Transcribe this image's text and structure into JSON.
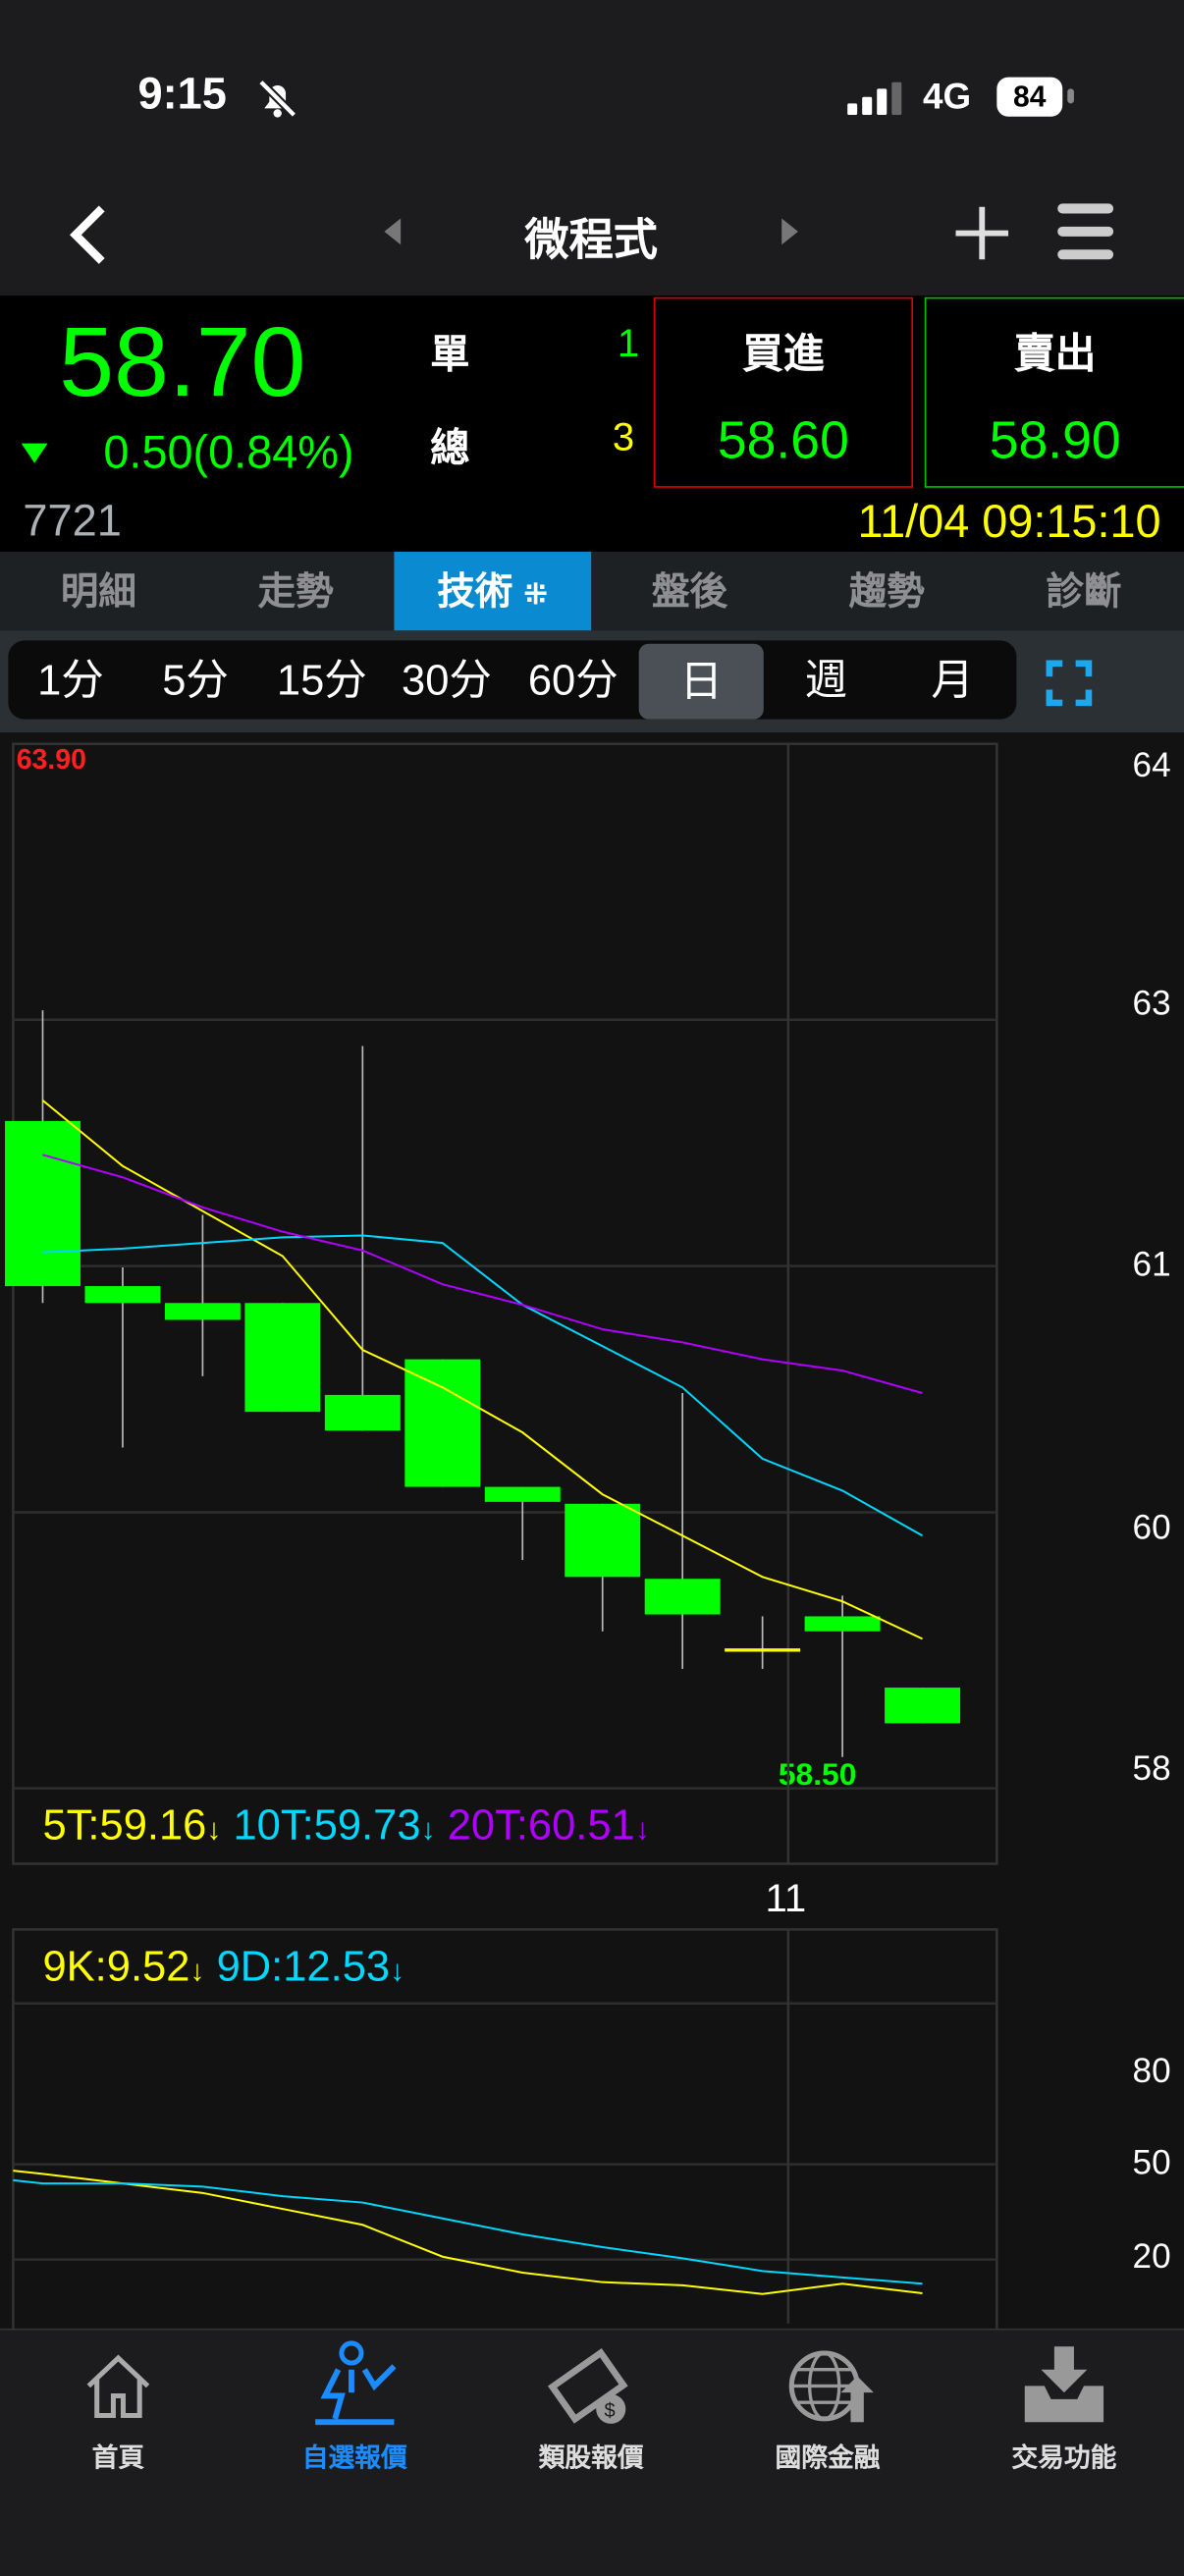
{
  "status_bar": {
    "time": "9:15",
    "network": "4G",
    "battery": "84"
  },
  "nav": {
    "title": "微程式"
  },
  "quote": {
    "price": "58.70",
    "change": "0.50(0.84%)",
    "unit_label": "單",
    "unit_value": "1",
    "total_label": "總",
    "total_value": "3",
    "bid_label": "買進",
    "bid_price": "58.60",
    "ask_label": "賣出",
    "ask_price": "58.90",
    "code": "7721",
    "datetime": "11/04 09:15:10"
  },
  "tabs": [
    {
      "label": "明細"
    },
    {
      "label": "走勢"
    },
    {
      "label": "技術"
    },
    {
      "label": "盤後"
    },
    {
      "label": "趨勢"
    },
    {
      "label": "診斷"
    }
  ],
  "periods": [
    {
      "label": "1分"
    },
    {
      "label": "5分"
    },
    {
      "label": "15分"
    },
    {
      "label": "30分"
    },
    {
      "label": "60分"
    },
    {
      "label": "日"
    },
    {
      "label": "週"
    },
    {
      "label": "月"
    }
  ],
  "colors": {
    "up": "#ff0000",
    "down": "#00ff00",
    "ma5": "#ffff00",
    "ma10": "#00d8ff",
    "ma20": "#b000ff",
    "accent": "#0a8bd1"
  },
  "chart_data": [
    {
      "type": "candlestick",
      "title": "日K",
      "high_label": "63.90",
      "low_label": "58.50",
      "y_tick_labels": [
        "64",
        "63",
        "61",
        "60",
        "58"
      ],
      "x_tick_labels": [
        "11"
      ],
      "ylim": [
        58.5,
        63.9
      ],
      "candles": [
        {
          "o": 61.89,
          "h": 62.48,
          "l": 60.92,
          "c": 61.01
        },
        {
          "o": 61.01,
          "h": 61.11,
          "l": 60.15,
          "c": 60.92
        },
        {
          "o": 60.92,
          "h": 61.39,
          "l": 60.53,
          "c": 60.83
        },
        {
          "o": 60.92,
          "h": 60.92,
          "l": 60.34,
          "c": 60.34
        },
        {
          "o": 60.43,
          "h": 62.29,
          "l": 60.24,
          "c": 60.24
        },
        {
          "o": 60.62,
          "h": 60.62,
          "l": 59.94,
          "c": 59.94
        },
        {
          "o": 59.94,
          "h": 59.94,
          "l": 59.55,
          "c": 59.86
        },
        {
          "o": 59.85,
          "h": 59.85,
          "l": 59.17,
          "c": 59.46
        },
        {
          "o": 59.45,
          "h": 60.44,
          "l": 58.97,
          "c": 59.26
        },
        {
          "o": 59.07,
          "h": 59.25,
          "l": 58.97,
          "c": 59.07
        },
        {
          "o": 59.25,
          "h": 59.36,
          "l": 58.5,
          "c": 59.17
        },
        {
          "o": 58.87,
          "h": 58.87,
          "l": 58.68,
          "c": 58.68
        }
      ],
      "series": [
        {
          "name": "5T",
          "label": "5T:59.16",
          "values": [
            62.0,
            61.65,
            61.41,
            61.17,
            60.67,
            60.47,
            60.23,
            59.9,
            59.68,
            59.46,
            59.33,
            59.13
          ]
        },
        {
          "name": "10T",
          "label": "10T:59.73",
          "values": [
            61.19,
            61.21,
            61.24,
            61.27,
            61.28,
            61.24,
            60.91,
            60.69,
            60.47,
            60.09,
            59.92,
            59.68
          ]
        },
        {
          "name": "20T",
          "label": "20T:60.51",
          "values": [
            61.71,
            61.59,
            61.43,
            61.3,
            61.2,
            61.02,
            60.91,
            60.78,
            60.71,
            60.62,
            60.56,
            60.44
          ]
        }
      ]
    },
    {
      "type": "line",
      "title": "KD",
      "ylim": [
        0,
        100
      ],
      "y_tick_labels": [
        "80",
        "50",
        "20"
      ],
      "series": [
        {
          "name": "9K",
          "label": "9K:9.52",
          "values": [
            47,
            44,
            41,
            36,
            31,
            21,
            16,
            13,
            12,
            9.3,
            12.5,
            9.52
          ]
        },
        {
          "name": "9D",
          "label": "9D:12.53",
          "values": [
            44,
            44,
            43,
            40,
            38,
            33,
            28,
            24,
            20.5,
            16.5,
            14.5,
            12.53
          ]
        }
      ]
    }
  ],
  "bottom_nav": [
    {
      "label": "首頁"
    },
    {
      "label": "自選報價"
    },
    {
      "label": "類股報價"
    },
    {
      "label": "國際金融"
    },
    {
      "label": "交易功能"
    }
  ]
}
